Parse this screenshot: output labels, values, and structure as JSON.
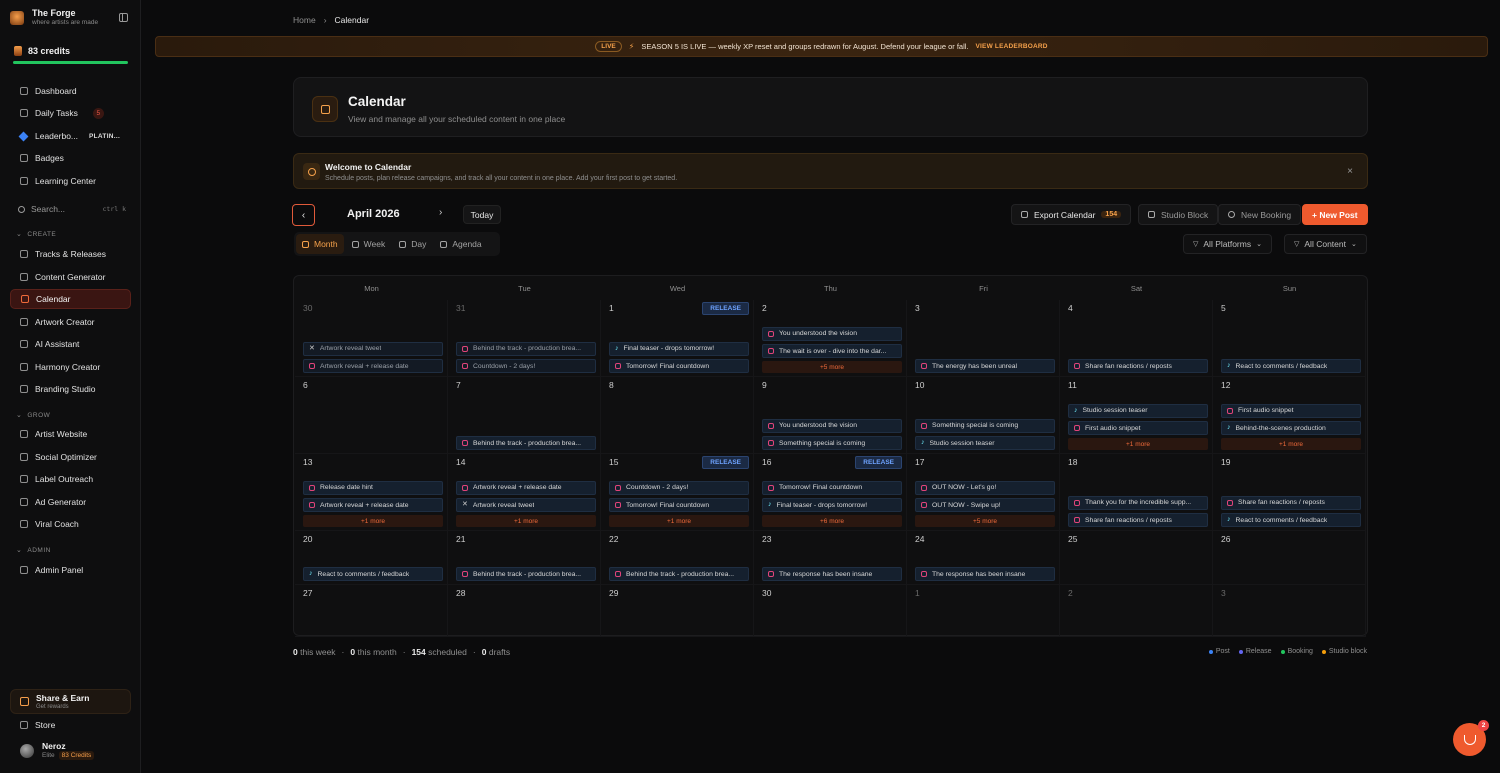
{
  "app": {
    "name": "The Forge",
    "tagline": "where artists are made"
  },
  "sidebar": {
    "credits": "83 credits",
    "top_items": [
      {
        "label": "Dashboard",
        "icon": "grid-icon"
      },
      {
        "label": "Daily Tasks",
        "icon": "clock-icon",
        "count": "5"
      },
      {
        "label": "Leaderbo...",
        "icon": "diamond-icon",
        "tier": "PLATIN..."
      },
      {
        "label": "Badges",
        "icon": "badge-icon"
      },
      {
        "label": "Learning Center",
        "icon": "book-icon"
      }
    ],
    "search": {
      "placeholder": "Search...",
      "shortcut": "ctrl k"
    },
    "sections": [
      {
        "title": "CREATE",
        "items": [
          "Tracks & Releases",
          "Content Generator",
          "Calendar",
          "Artwork Creator",
          "AI Assistant",
          "Harmony Creator",
          "Branding Studio"
        ]
      },
      {
        "title": "GROW",
        "items": [
          "Artist Website",
          "Social Optimizer",
          "Label Outreach",
          "Ad Generator",
          "Viral Coach"
        ]
      },
      {
        "title": "ADMIN",
        "items": [
          "Admin Panel"
        ]
      }
    ],
    "active_item": "Calendar",
    "share": {
      "title": "Share & Earn",
      "subtitle": "Get rewards"
    },
    "store": "Store",
    "user": {
      "name": "Neroz",
      "plan": "Elite",
      "credits": "83 Credits"
    }
  },
  "breadcrumb": {
    "home": "Home",
    "current": "Calendar"
  },
  "banner": {
    "pill": "LIVE",
    "text": "SEASON 5 IS LIVE — weekly XP reset and groups redrawn for August. Defend your league or fall.",
    "link": "VIEW LEADERBOARD"
  },
  "header": {
    "title": "Calendar",
    "subtitle": "View and manage all your scheduled content in one place"
  },
  "welcome": {
    "title": "Welcome to Calendar",
    "subtitle": "Schedule posts, plan release campaigns, and track all your content in one place. Add your first post to get started."
  },
  "toolbar": {
    "month_label": "April 2026",
    "today": "Today",
    "export": "Export Calendar",
    "export_count": "154",
    "studio_block": "Studio Block",
    "new_booking": "New Booking",
    "new_post": "+ New Post",
    "views": [
      "Month",
      "Week",
      "Day",
      "Agenda"
    ],
    "active_view": "Month",
    "filter_platforms": "All Platforms",
    "filter_content": "All Content"
  },
  "calendar": {
    "weekdays": [
      "Mon",
      "Tue",
      "Wed",
      "Thu",
      "Fri",
      "Sat",
      "Sun"
    ],
    "weeks": [
      [
        {
          "day": "30",
          "other": true,
          "events": [
            {
              "p": "x",
              "t": "Artwork reveal tweet",
              "dim": true
            },
            {
              "p": "ig",
              "t": "Artwork reveal + release date",
              "dim": true
            }
          ]
        },
        {
          "day": "31",
          "other": true,
          "events": [
            {
              "p": "ig",
              "t": "Behind the track - production brea...",
              "dim": true
            },
            {
              "p": "ig",
              "t": "Countdown - 2 days!",
              "dim": true
            }
          ]
        },
        {
          "day": "1",
          "release": "RELEASE",
          "events": [
            {
              "p": "tt",
              "t": "Final teaser - drops tomorrow!"
            },
            {
              "p": "ig",
              "t": "Tomorrow! Final countdown"
            }
          ]
        },
        {
          "day": "2",
          "events": [
            {
              "p": "ig",
              "t": "You understood the vision"
            },
            {
              "p": "ig",
              "t": "The wait is over - dive into the dar..."
            }
          ],
          "more": "+5 more"
        },
        {
          "day": "3",
          "events": [
            {
              "p": "ig",
              "t": "The energy has been unreal"
            }
          ]
        },
        {
          "day": "4",
          "events": [
            {
              "p": "ig",
              "t": "Share fan reactions / reposts"
            }
          ]
        },
        {
          "day": "5",
          "events": [
            {
              "p": "tt",
              "t": "React to comments / feedback"
            }
          ]
        }
      ],
      [
        {
          "day": "6",
          "events": []
        },
        {
          "day": "7",
          "events": [
            {
              "p": "ig",
              "t": "Behind the track - production brea..."
            }
          ]
        },
        {
          "day": "8",
          "events": []
        },
        {
          "day": "9",
          "events": [
            {
              "p": "ig",
              "t": "You understood the vision"
            },
            {
              "p": "ig",
              "t": "Something special is coming"
            }
          ]
        },
        {
          "day": "10",
          "events": [
            {
              "p": "ig",
              "t": "Something special is coming"
            },
            {
              "p": "tt",
              "t": "Studio session teaser"
            }
          ]
        },
        {
          "day": "11",
          "events": [
            {
              "p": "tt",
              "t": "Studio session teaser"
            },
            {
              "p": "ig",
              "t": "First audio snippet"
            }
          ],
          "more": "+1 more"
        },
        {
          "day": "12",
          "events": [
            {
              "p": "ig",
              "t": "First audio snippet"
            },
            {
              "p": "tt",
              "t": "Behind-the-scenes production"
            }
          ],
          "more": "+1 more"
        }
      ],
      [
        {
          "day": "13",
          "events": [
            {
              "p": "ig",
              "t": "Release date hint"
            },
            {
              "p": "ig",
              "t": "Artwork reveal + release date"
            }
          ],
          "more": "+1 more"
        },
        {
          "day": "14",
          "events": [
            {
              "p": "ig",
              "t": "Artwork reveal + release date"
            },
            {
              "p": "x",
              "t": "Artwork reveal tweet"
            }
          ],
          "more": "+1 more"
        },
        {
          "day": "15",
          "release": "RELEASE",
          "events": [
            {
              "p": "ig",
              "t": "Countdown - 2 days!"
            },
            {
              "p": "ig",
              "t": "Tomorrow! Final countdown"
            }
          ],
          "more": "+1 more"
        },
        {
          "day": "16",
          "release": "RELEASE",
          "events": [
            {
              "p": "ig",
              "t": "Tomorrow! Final countdown"
            },
            {
              "p": "tt",
              "t": "Final teaser - drops tomorrow!"
            }
          ],
          "more": "+6 more"
        },
        {
          "day": "17",
          "events": [
            {
              "p": "ig",
              "t": "OUT NOW - Let's go!"
            },
            {
              "p": "ig",
              "t": "OUT NOW - Swipe up!"
            }
          ],
          "more": "+5 more"
        },
        {
          "day": "18",
          "events": [
            {
              "p": "ig",
              "t": "Thank you for the incredible supp..."
            },
            {
              "p": "ig",
              "t": "Share fan reactions / reposts"
            }
          ]
        },
        {
          "day": "19",
          "events": [
            {
              "p": "ig",
              "t": "Share fan reactions / reposts"
            },
            {
              "p": "tt",
              "t": "React to comments / feedback"
            }
          ]
        }
      ],
      [
        {
          "day": "20",
          "events": [
            {
              "p": "tt",
              "t": "React to comments / feedback"
            }
          ]
        },
        {
          "day": "21",
          "events": [
            {
              "p": "ig",
              "t": "Behind the track - production brea..."
            }
          ]
        },
        {
          "day": "22",
          "events": [
            {
              "p": "ig",
              "t": "Behind the track - production brea..."
            }
          ]
        },
        {
          "day": "23",
          "events": [
            {
              "p": "ig",
              "t": "The response has been insane"
            }
          ]
        },
        {
          "day": "24",
          "events": [
            {
              "p": "ig",
              "t": "The response has been insane"
            }
          ]
        },
        {
          "day": "25",
          "events": []
        },
        {
          "day": "26",
          "events": []
        }
      ],
      [
        {
          "day": "27",
          "events": []
        },
        {
          "day": "28",
          "events": []
        },
        {
          "day": "29",
          "events": []
        },
        {
          "day": "30",
          "events": []
        },
        {
          "day": "1",
          "other": true,
          "events": []
        },
        {
          "day": "2",
          "other": true,
          "events": []
        },
        {
          "day": "3",
          "other": true,
          "events": []
        }
      ]
    ]
  },
  "stats": {
    "week": "0",
    "week_label": "this week",
    "month": "0",
    "month_label": "this month",
    "scheduled": "154",
    "scheduled_label": "scheduled",
    "drafts": "0",
    "drafts_label": "drafts"
  },
  "legend": [
    {
      "label": "Post",
      "color": "#3b82f6"
    },
    {
      "label": "Release",
      "color": "#6366f1"
    },
    {
      "label": "Booking",
      "color": "#22c55e"
    },
    {
      "label": "Studio block",
      "color": "#f59e0b"
    }
  ],
  "fab": {
    "badge": "2"
  }
}
